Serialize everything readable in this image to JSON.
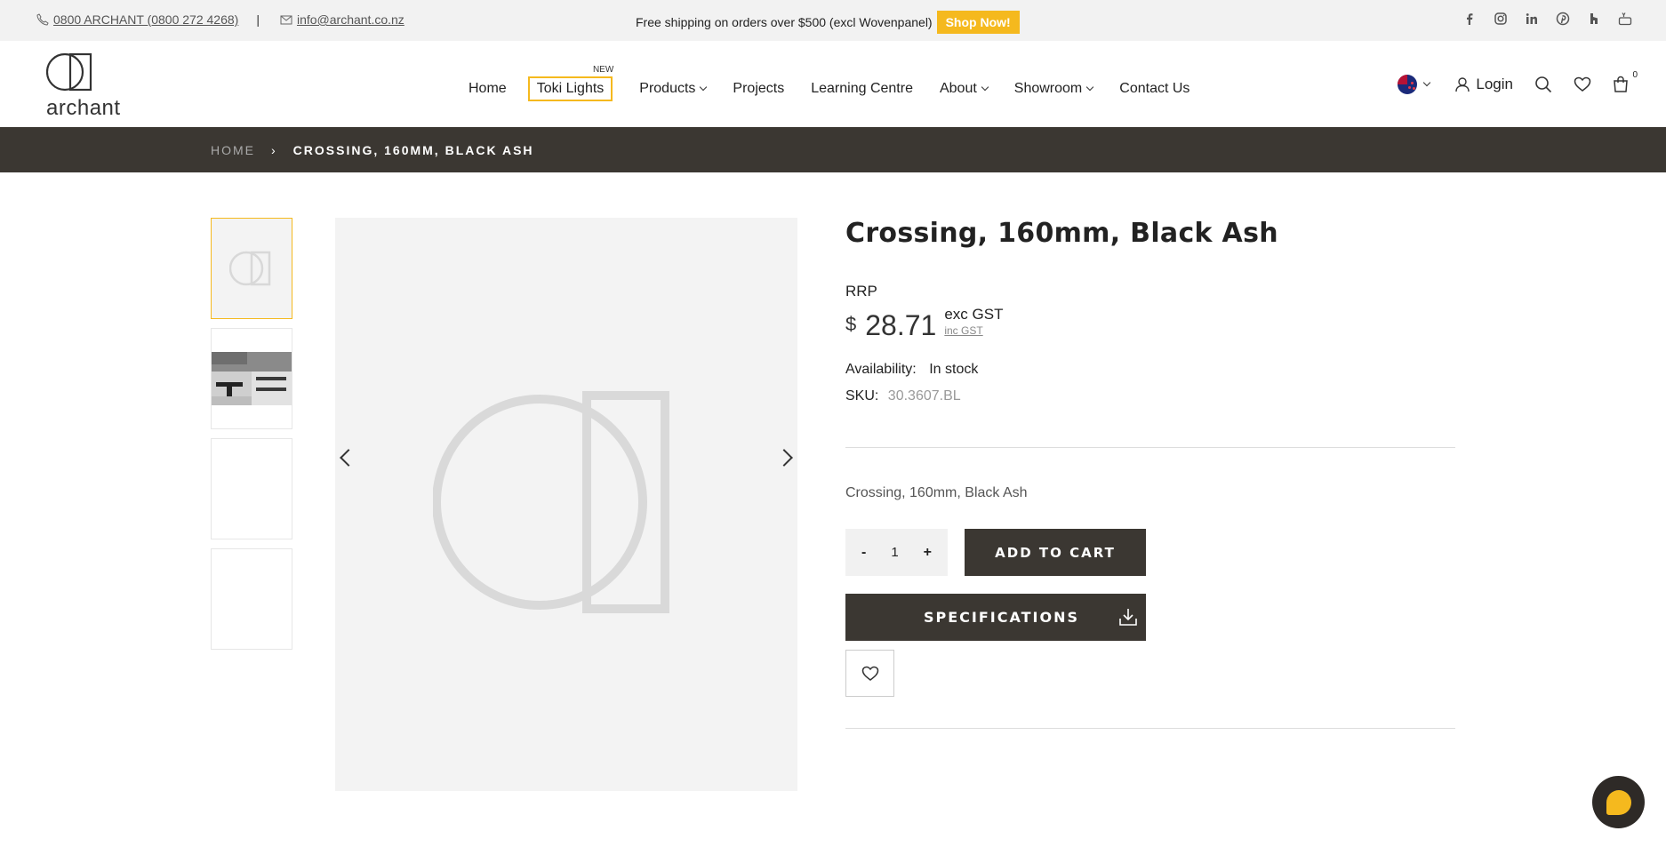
{
  "topbar": {
    "phone": "0800 ARCHANT (0800 272 4268)",
    "separator": "|",
    "email": "info@archant.co.nz",
    "promo": "Free shipping on orders over $500 (excl Wovenpanel)",
    "shop_now": "Shop Now!",
    "social": [
      "facebook-icon",
      "instagram-icon",
      "linkedin-icon",
      "pinterest-icon",
      "houzz-icon",
      "youtube-icon"
    ]
  },
  "header": {
    "logo_text": "archant",
    "nav": {
      "home": "Home",
      "toki": "Toki Lights",
      "toki_badge": "NEW",
      "products": "Products",
      "projects": "Projects",
      "learning": "Learning Centre",
      "about": "About",
      "showroom": "Showroom",
      "contact": "Contact Us"
    },
    "login": "Login",
    "cart_count": "0"
  },
  "breadcrumb": {
    "home": "HOME",
    "separator": "›",
    "current": "CROSSING, 160MM, BLACK ASH"
  },
  "product": {
    "title": "Crossing, 160mm, Black Ash",
    "rrp_label": "RRP",
    "currency": "$",
    "price": "28.71",
    "exc_gst": "exc GST",
    "inc_gst": "inc GST",
    "availability_label": "Availability:",
    "availability": "In stock",
    "sku_label": "SKU:",
    "sku": "30.3607.BL",
    "description": "Crossing, 160mm, Black Ash",
    "quantity": "1",
    "qty_minus": "-",
    "qty_plus": "+",
    "add_to_cart": "ADD TO CART",
    "specifications": "SPECIFICATIONS"
  },
  "colors": {
    "accent": "#f5b91e",
    "dark": "#3b3732"
  }
}
